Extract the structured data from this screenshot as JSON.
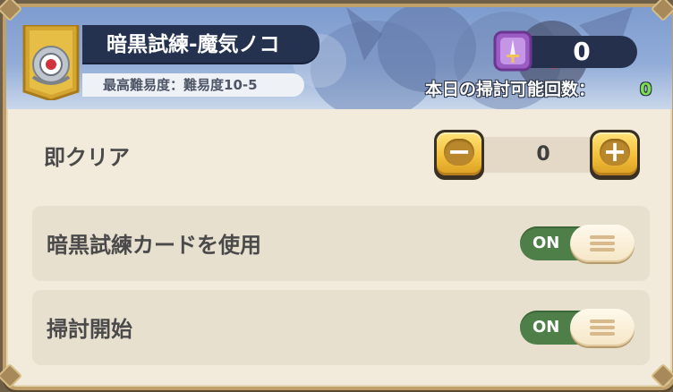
{
  "header": {
    "title": "暗黒試練-魔気ノコ",
    "difficulty": "最高難易度：難易度10-5",
    "currency_value": "0",
    "sweeps_label": "本日の掃討可能回数：",
    "sweeps_value": "0",
    "emblem_icon": "eye-emblem-icon",
    "currency_icon": "scroll-sword-icon"
  },
  "instant_clear": {
    "label": "即クリア",
    "quantity": "0",
    "minus_glyph": "−",
    "plus_glyph": "+"
  },
  "options": [
    {
      "label": "暗黒試練カードを使用",
      "toggle_text": "ON"
    },
    {
      "label": "掃討開始",
      "toggle_text": "ON"
    }
  ],
  "colors": {
    "panel_bg": "#f2ebdc",
    "header_bg": "#8fa8d6",
    "toggle_on": "#4e7f48",
    "button_gold": "#f3c03a",
    "sweeps_value": "#7ce04d"
  }
}
